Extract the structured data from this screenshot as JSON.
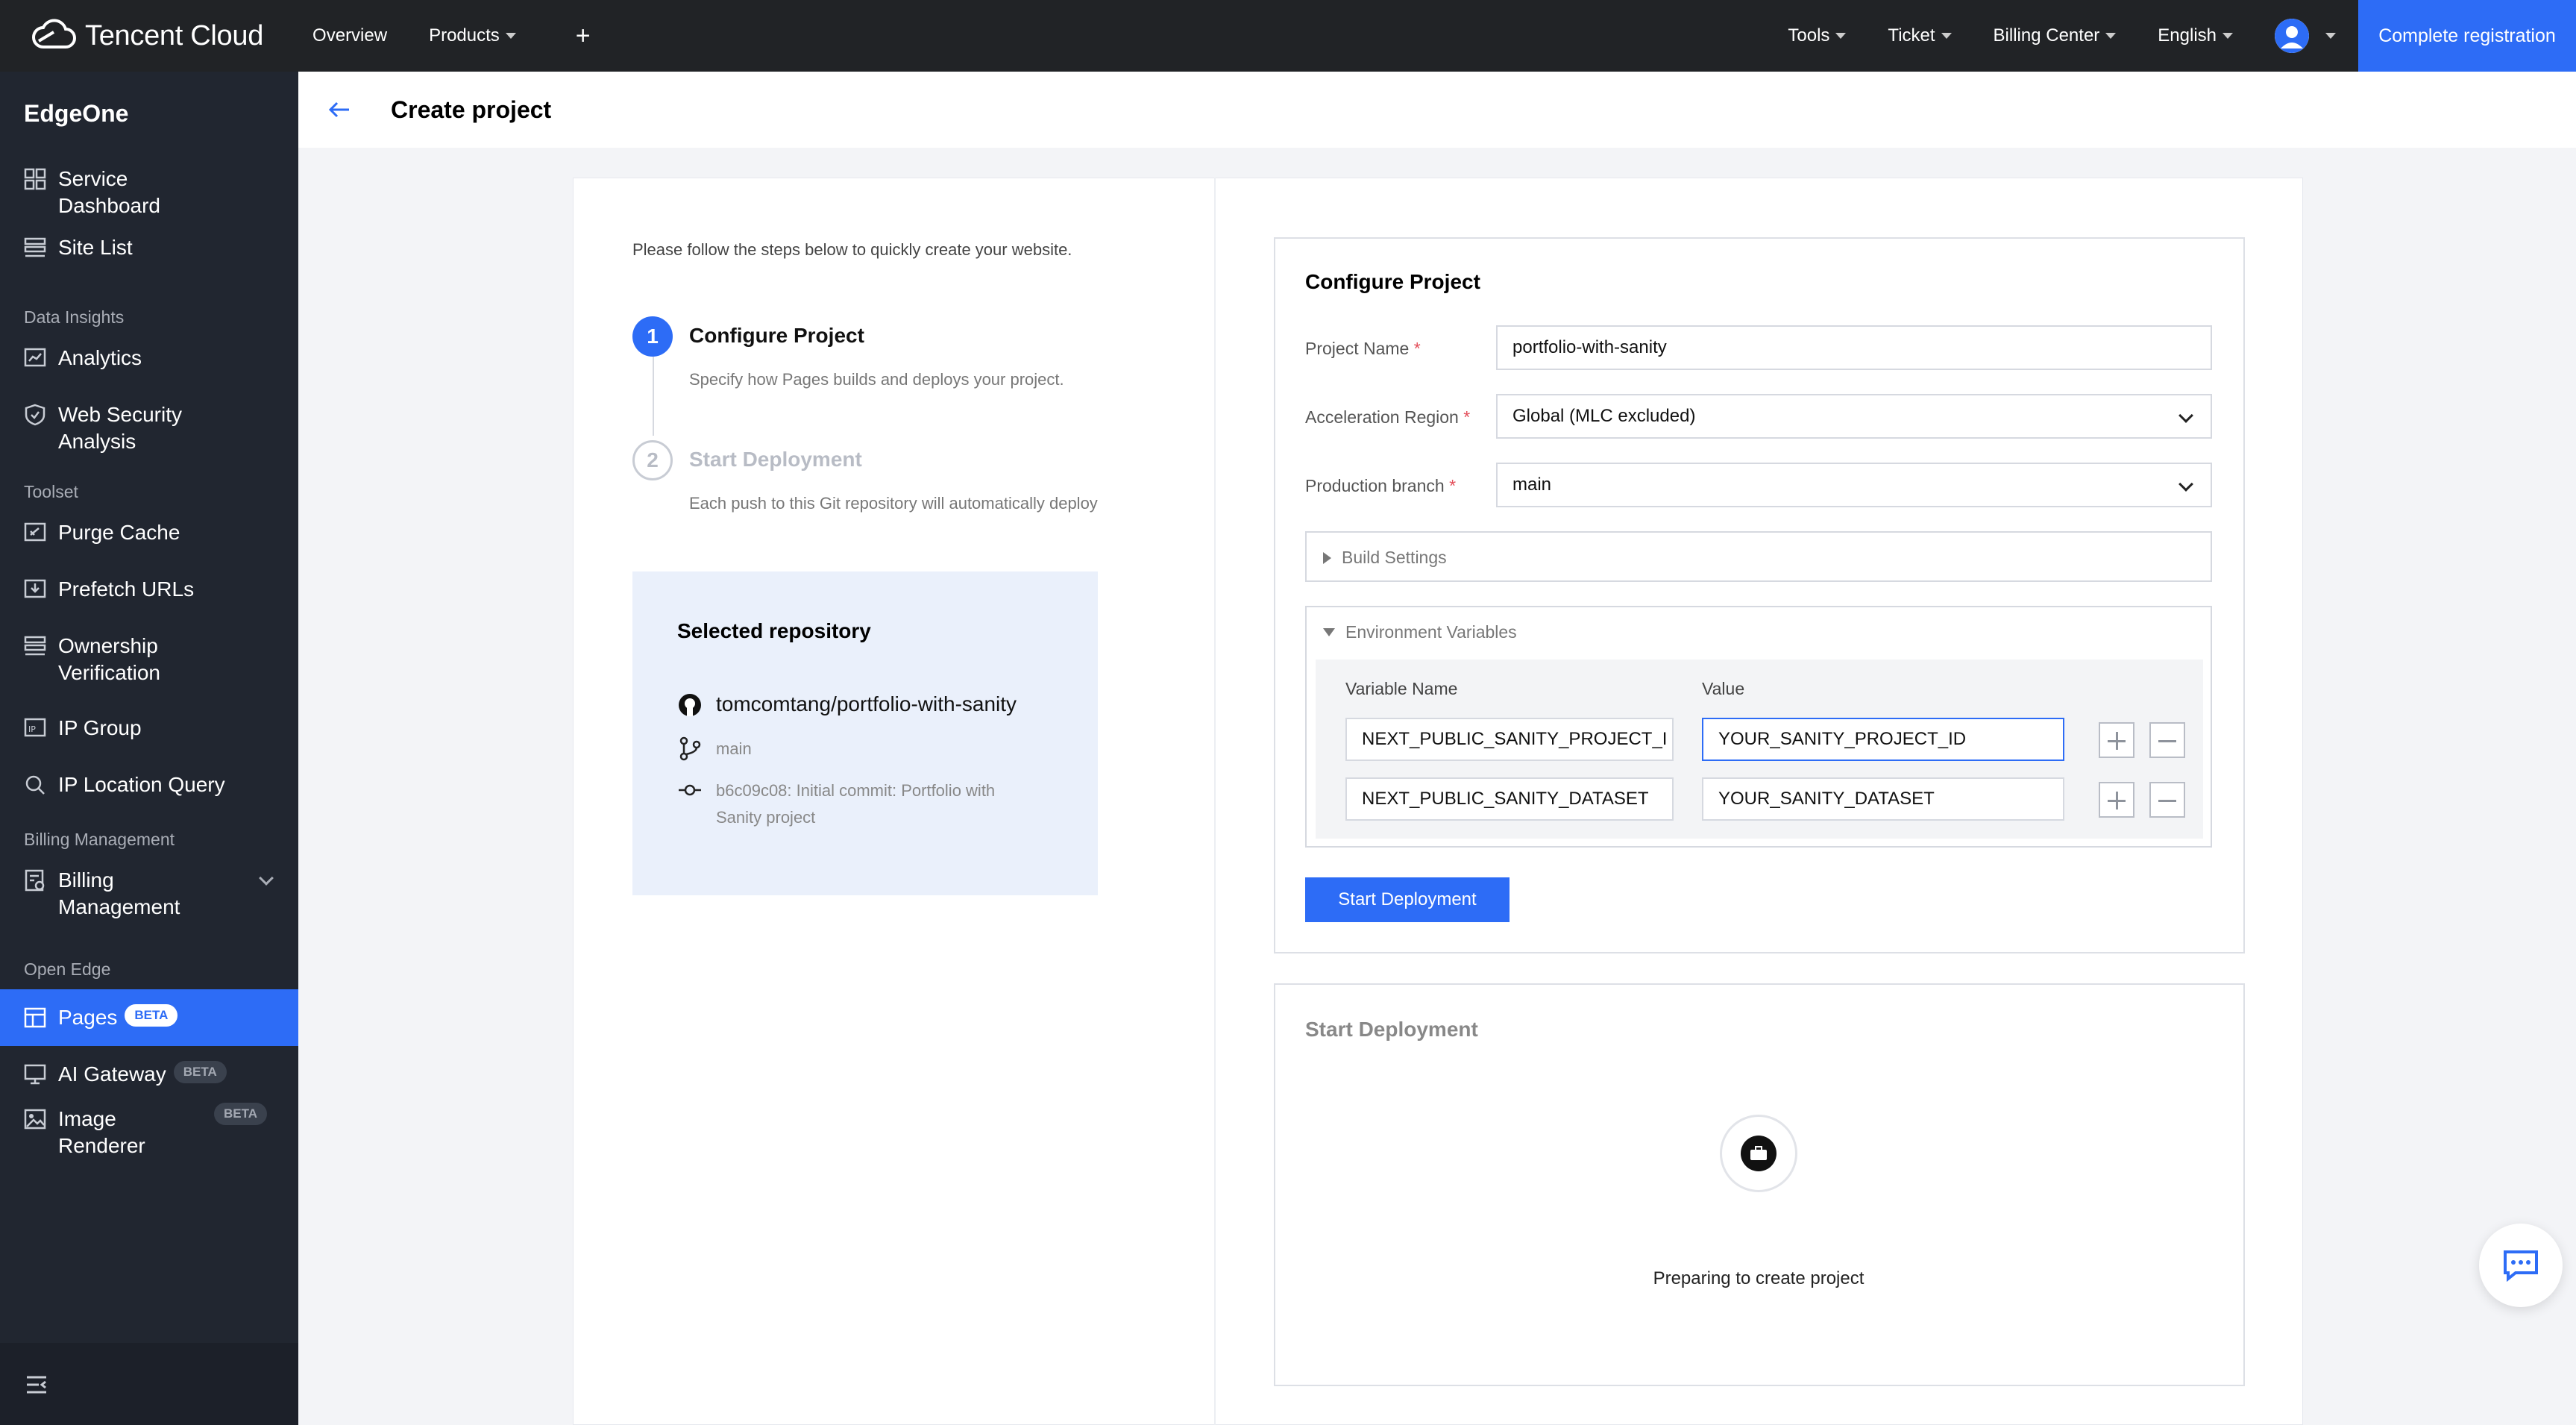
{
  "topbar": {
    "brand": "Tencent Cloud",
    "nav": [
      "Overview",
      "Products"
    ],
    "right_nav": [
      "Tools",
      "Ticket",
      "Billing Center",
      "English"
    ],
    "cta": "Complete registration"
  },
  "sidebar": {
    "product_title": "EdgeOne",
    "items": [
      {
        "label": "Service Dashboard",
        "icon": "dashboard-icon"
      },
      {
        "label": "Site List",
        "icon": "list-icon"
      }
    ],
    "sections": {
      "data_insights": "Data Insights",
      "toolset": "Toolset",
      "billing": "Billing Management",
      "open_edge": "Open Edge"
    },
    "data_items": [
      {
        "label": "Analytics"
      },
      {
        "label": "Web Security Analysis"
      }
    ],
    "tool_items": [
      {
        "label": "Purge Cache"
      },
      {
        "label": "Prefetch URLs"
      },
      {
        "label": "Ownership Verification"
      },
      {
        "label": "IP Group"
      },
      {
        "label": "IP Location Query"
      }
    ],
    "billing_items": [
      {
        "label": "Billing Management"
      }
    ],
    "open_edge_items": [
      {
        "label": "Pages",
        "badge": "BETA"
      },
      {
        "label": "AI Gateway",
        "badge": "BETA"
      },
      {
        "label": "Image Renderer",
        "badge": "BETA"
      }
    ]
  },
  "header": {
    "title": "Create project"
  },
  "steps": {
    "intro": "Please follow the steps below to quickly create your website.",
    "items": [
      {
        "number": "1",
        "title": "Configure Project",
        "desc": "Specify how Pages builds and deploys your project."
      },
      {
        "number": "2",
        "title": "Start Deployment",
        "desc": "Each push to this Git repository will automatically deploy"
      }
    ]
  },
  "repo": {
    "title": "Selected repository",
    "name": "tomcomtang/portfolio-with-sanity",
    "branch": "main",
    "commit": "b6c09c08: Initial commit: Portfolio with Sanity project"
  },
  "configure": {
    "title": "Configure Project",
    "project_name_label": "Project Name",
    "project_name": "portfolio-with-sanity",
    "region_label": "Acceleration Region",
    "region": "Global (MLC excluded)",
    "branch_label": "Production branch",
    "branch": "main",
    "build_settings": "Build Settings",
    "env_vars": "Environment Variables",
    "env_head_name": "Variable Name",
    "env_head_value": "Value",
    "env_rows": [
      {
        "name": "NEXT_PUBLIC_SANITY_PROJECT_I",
        "value": "YOUR_SANITY_PROJECT_ID"
      },
      {
        "name": "NEXT_PUBLIC_SANITY_DATASET",
        "value": "YOUR_SANITY_DATASET"
      }
    ],
    "submit": "Start Deployment"
  },
  "deploy": {
    "title": "Start Deployment",
    "status": "Preparing to create project"
  },
  "colors": {
    "accent": "#2d6cf6",
    "topbar": "#212326",
    "sidebar": "#212630"
  }
}
